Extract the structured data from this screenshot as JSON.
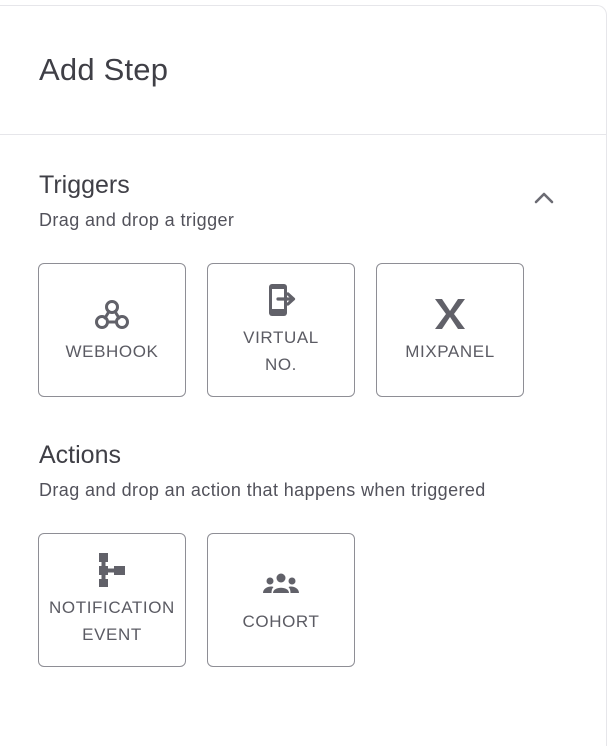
{
  "header": {
    "title": "Add Step"
  },
  "triggers": {
    "title": "Triggers",
    "subtitle": "Drag and drop a trigger",
    "collapse_icon": "chevron-up-icon",
    "items": [
      {
        "label": "WEBHOOK",
        "icon": "webhook-icon"
      },
      {
        "label": "VIRTUAL\nNO.",
        "icon": "phone-exit-icon"
      },
      {
        "label": "MIXPANEL",
        "icon": "mixpanel-logo-icon"
      }
    ]
  },
  "actions": {
    "title": "Actions",
    "subtitle": "Drag and drop an action that happens when triggered",
    "items": [
      {
        "label": "NOTIFICATION\nEVENT",
        "icon": "flow-tree-icon"
      },
      {
        "label": "COHORT",
        "icon": "group-icon"
      }
    ]
  },
  "colors": {
    "text": "#3f3f46",
    "icon": "#616169",
    "card_border": "#8e8e95",
    "divider": "#e6e6ea"
  }
}
